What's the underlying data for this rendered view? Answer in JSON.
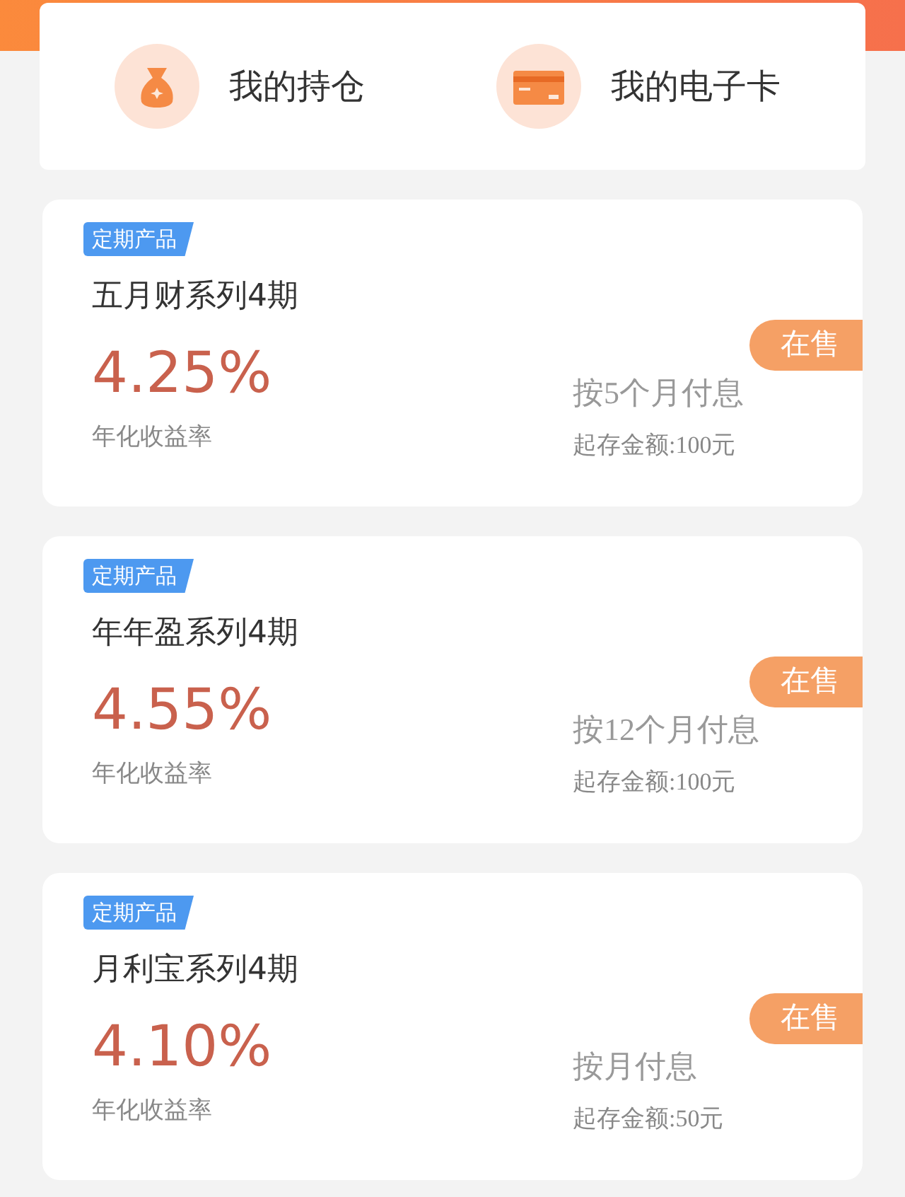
{
  "shortcuts": [
    {
      "label": "我的持仓",
      "kind": "bag"
    },
    {
      "label": "我的电子卡",
      "kind": "card"
    }
  ],
  "products": [
    {
      "tag": "定期产品",
      "name": "五月财系列4期",
      "rate": "4.25%",
      "rate_label": "年化收益率",
      "status": "在售",
      "payout": "按5个月付息",
      "minimum": "起存金额:100元"
    },
    {
      "tag": "定期产品",
      "name": "年年盈系列4期",
      "rate": "4.55%",
      "rate_label": "年化收益率",
      "status": "在售",
      "payout": "按12个月付息",
      "minimum": "起存金额:100元"
    },
    {
      "tag": "定期产品",
      "name": "月利宝系列4期",
      "rate": "4.10%",
      "rate_label": "年化收益率",
      "status": "在售",
      "payout": "按月付息",
      "minimum": "起存金额:50元"
    }
  ]
}
